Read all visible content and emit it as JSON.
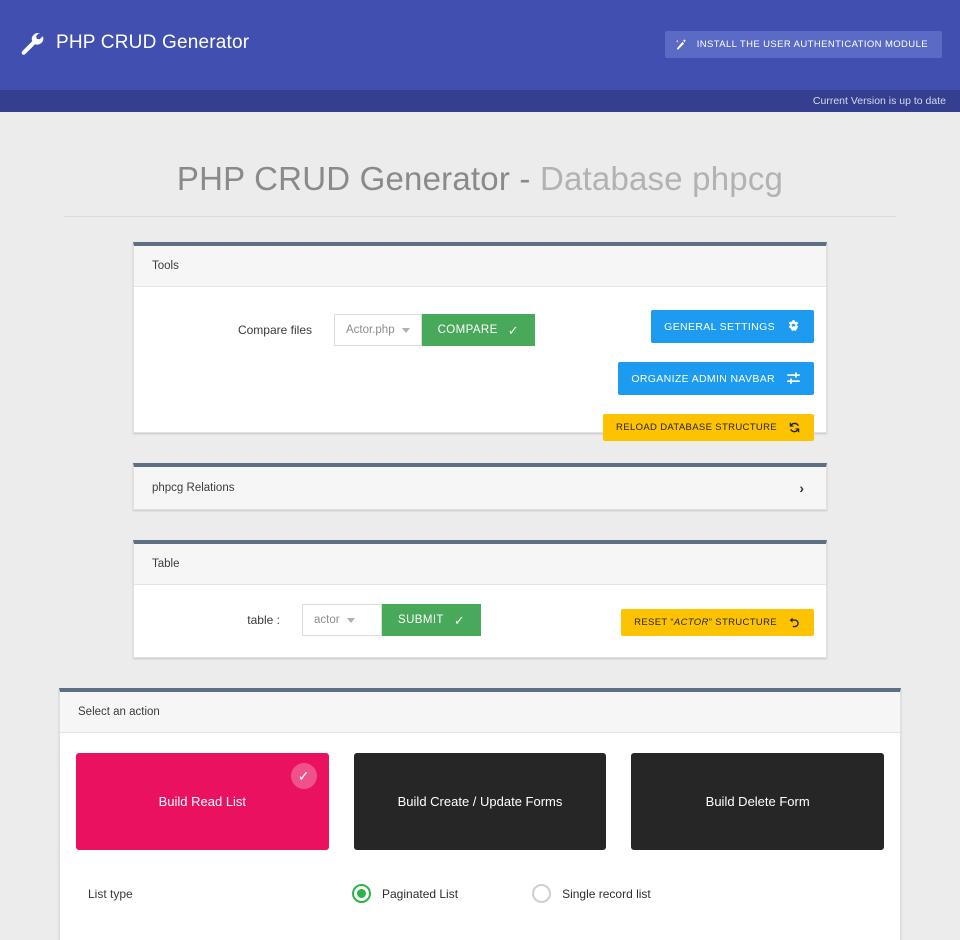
{
  "navbar": {
    "brand": "PHP CRUD Generator",
    "brand_icon": "wrench-icon",
    "install_button": "INSTALL THE USER AUTHENTICATION MODULE",
    "install_icon": "magic-wand-icon",
    "bg": "#4150b0"
  },
  "version_bar": {
    "text": "Current Version is up to date",
    "bg": "#343f8f"
  },
  "page": {
    "title_main": "PHP CRUD Generator - ",
    "title_dim": "Database phpcg"
  },
  "tools_panel": {
    "heading": "Tools",
    "compare_label": "Compare files",
    "compare_select_value": "Actor.php",
    "compare_button": "COMPARE",
    "compare_button_icon": "check-icon",
    "general_settings_button": "GENERAL SETTINGS",
    "general_settings_icon": "gears-icon",
    "organize_navbar_button": "ORGANIZE ADMIN NAVBAR",
    "organize_navbar_icon": "sliders-icon",
    "reload_db_button": "RELOAD DATABASE STRUCTURE",
    "reload_db_icon": "refresh-icon"
  },
  "relations_panel": {
    "heading": "phpcg Relations",
    "chevron": "›",
    "chevron_icon": "chevron-right-icon"
  },
  "table_panel": {
    "heading": "Table",
    "table_label": "table :",
    "table_select_value": "actor",
    "submit_button": "SUBMIT",
    "submit_button_icon": "check-icon",
    "reset_prefix": "RESET “",
    "reset_table": "ACTOR",
    "reset_suffix": "” STRUCTURE",
    "reset_icon": "undo-icon"
  },
  "action_panel": {
    "heading": "Select an action",
    "cards": [
      {
        "label": "Build Read List",
        "selected": true,
        "color": "#ea1260",
        "badge_icon": "check-icon"
      },
      {
        "label": "Build Create / Update Forms",
        "selected": false,
        "color": "#262626"
      },
      {
        "label": "Build Delete Form",
        "selected": false,
        "color": "#262626"
      }
    ],
    "list_type_label": "List type",
    "options": [
      {
        "label": "Paginated List",
        "selected": true
      },
      {
        "label": "Single record list",
        "selected": false
      }
    ],
    "radio_color": "#2eb34a"
  },
  "theme": {
    "page_bg": "#ececec",
    "panel_top_border": "#5d7083",
    "green": "#49a95a",
    "blue": "#1d9bf0",
    "yellow": "#fdc300"
  }
}
